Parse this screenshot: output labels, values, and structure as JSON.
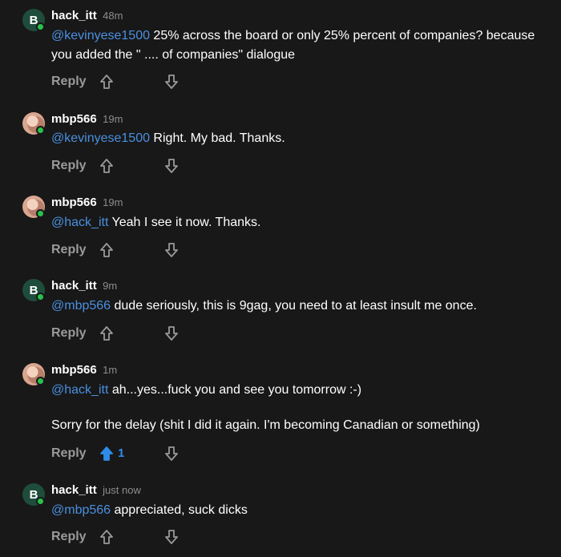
{
  "reply_label": "Reply",
  "colors": {
    "background": "#181818",
    "mention": "#4a8fe0",
    "upvoted": "#2f8ce8",
    "online": "#27c24c",
    "letter_avatar": "#1f4d3c"
  },
  "comments": [
    {
      "username": "hack_itt",
      "time": "48m",
      "avatar_letter": "B",
      "mention": "@kevinyese1500",
      "text": " 25% across the board or only 25% percent of companies? because you added the \" .... of companies\" dialogue"
    },
    {
      "username": "mbp566",
      "time": "19m",
      "mention": "@kevinyese1500",
      "text": " Right. My bad. Thanks."
    },
    {
      "username": "mbp566",
      "time": "19m",
      "mention": "@hack_itt",
      "text": " Yeah I see it now. Thanks."
    },
    {
      "username": "hack_itt",
      "time": "9m",
      "avatar_letter": "B",
      "mention": "@mbp566",
      "text": " dude seriously, this is 9gag, you need to at least insult me once."
    },
    {
      "username": "mbp566",
      "time": "1m",
      "mention": "@hack_itt",
      "text": " ah...yes...fuck you and see you tomorrow :-)",
      "text2": "Sorry for the delay (shit I did it again. I'm becoming Canadian or something)",
      "upvotes": "1",
      "upvoted": true
    },
    {
      "username": "hack_itt",
      "time": "just now",
      "avatar_letter": "B",
      "mention": "@mbp566",
      "text": " appreciated, suck dicks"
    }
  ]
}
